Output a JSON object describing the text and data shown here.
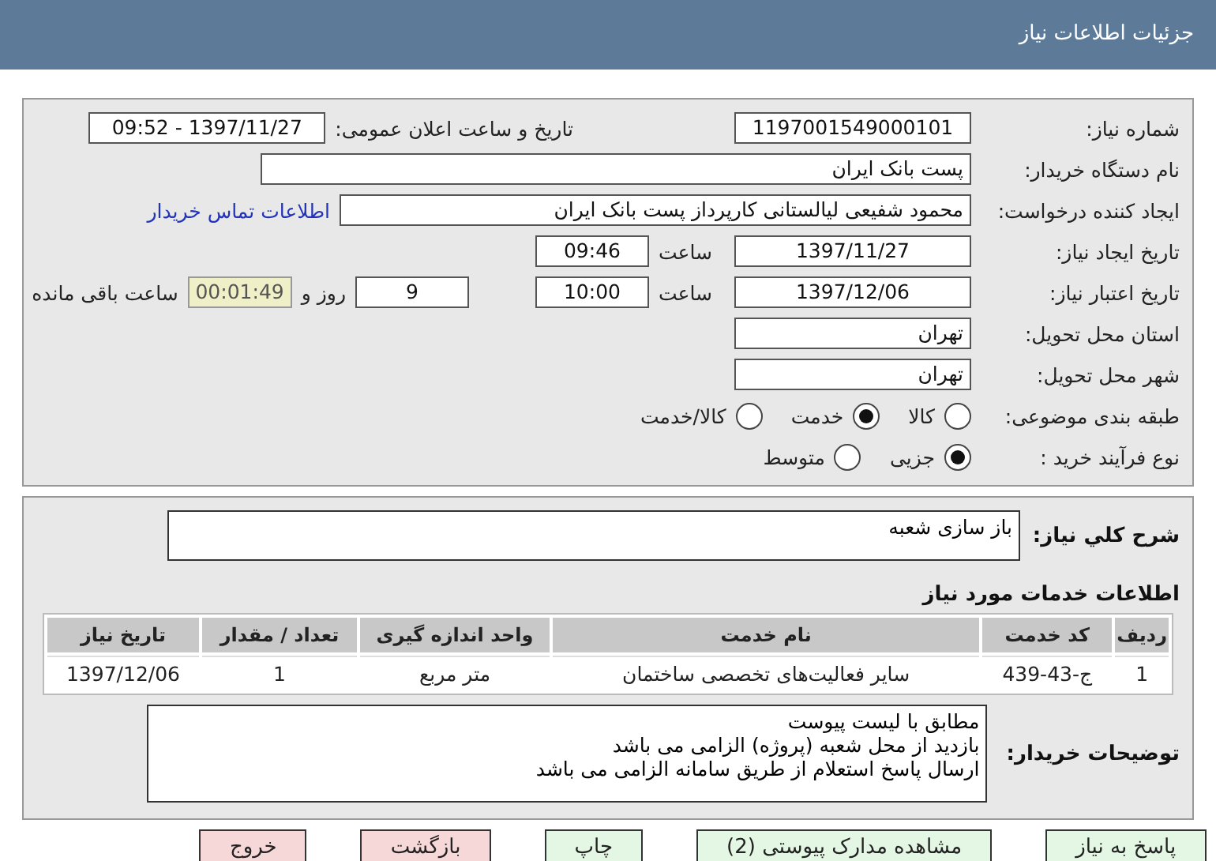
{
  "header": {
    "title": "جزئیات اطلاعات نیاز"
  },
  "need_number": {
    "label": "شماره نیاز:",
    "value": "1197001549000101"
  },
  "announce": {
    "label": "تاریخ و ساعت اعلان عمومی:",
    "value": "1397/11/27 - 09:52"
  },
  "buyer": {
    "label": "نام دستگاه خریدار:",
    "value": "پست بانک ایران"
  },
  "creator": {
    "label": "ایجاد کننده درخواست:",
    "value": "محمود شفیعی لیالستانی کارپرداز پست بانک ایران",
    "link": "اطلاعات تماس خریدار"
  },
  "created": {
    "label": "تاریخ ایجاد نیاز:",
    "date": "1397/11/27",
    "time_label": "ساعت",
    "time": "09:46"
  },
  "validity": {
    "label": "تاریخ اعتبار نیاز:",
    "date": "1397/12/06",
    "time_label": "ساعت",
    "time": "10:00",
    "days": "9",
    "days_label": "روز و",
    "remaining": "00:01:49",
    "remaining_label": "ساعت باقی مانده"
  },
  "province": {
    "label": "استان محل تحویل:",
    "value": "تهران"
  },
  "city": {
    "label": "شهر محل تحویل:",
    "value": "تهران"
  },
  "classification": {
    "label": "طبقه بندی موضوعی:",
    "options": [
      {
        "label": "کالا",
        "selected": false
      },
      {
        "label": "خدمت",
        "selected": true
      },
      {
        "label": "کالا/خدمت",
        "selected": false
      }
    ]
  },
  "process": {
    "label": "نوع فرآیند خرید :",
    "options": [
      {
        "label": "جزیی",
        "selected": true
      },
      {
        "label": "متوسط",
        "selected": false
      }
    ]
  },
  "description": {
    "label": "شرح کلي نياز:",
    "value": "باز سازی شعبه"
  },
  "services": {
    "title": "اطلاعات خدمات مورد نیاز",
    "columns": [
      "ردیف",
      "کد خدمت",
      "نام خدمت",
      "واحد اندازه گیری",
      "تعداد / مقدار",
      "تاریخ نیاز"
    ],
    "rows": [
      [
        "1",
        "ج-43-439",
        "سایر فعالیت‌های تخصصی ساختمان",
        "متر مربع",
        "1",
        "1397/12/06"
      ]
    ]
  },
  "notes": {
    "label": "توضیحات خریدار:",
    "lines": [
      "مطابق با لیست پیوست",
      "بازدید از محل شعبه (پروژه) الزامی می باشد",
      "ارسال پاسخ استعلام از طریق سامانه الزامی می باشد"
    ]
  },
  "buttons": [
    {
      "label": "پاسخ به نیاز",
      "color": "#e4f7e4"
    },
    {
      "label": "مشاهده مدارک پیوستی (2)",
      "color": "#e4f7e4"
    },
    {
      "label": "چاپ",
      "color": "#e4f7e4"
    },
    {
      "label": "بازگشت",
      "color": "#f7d8d8"
    },
    {
      "label": "خروج",
      "color": "#f7d8d8"
    }
  ]
}
